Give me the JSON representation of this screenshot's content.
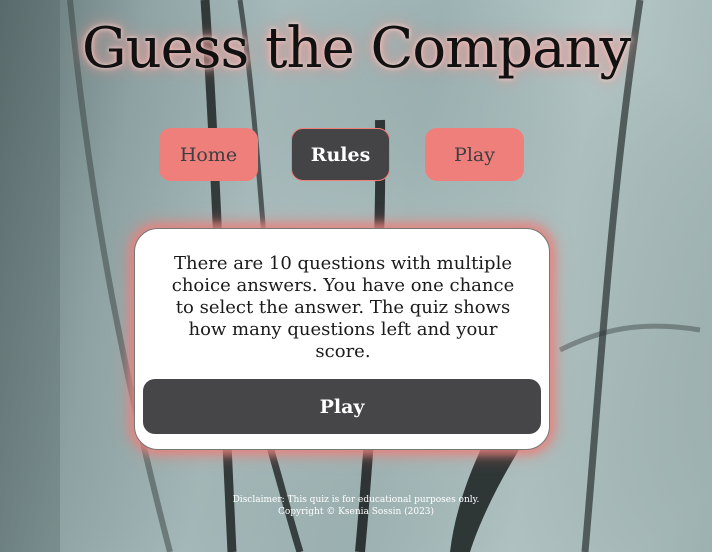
{
  "title": "Guess the Company",
  "nav": {
    "home_label": "Home",
    "rules_label": "Rules",
    "play_label": "Play"
  },
  "rules_card": {
    "text": "There are 10 questions with multiple choice answers. You have one chance to select the answer. The quiz shows how many questions left and your score.",
    "play_label": "Play"
  },
  "footer": {
    "disclaimer": "Disclaimer: This quiz is for educational purposes only.",
    "copyright": "Copyright © Ksenia Sossin (2023)"
  },
  "colors": {
    "accent": "#ee7f7b",
    "dark_button": "#444346",
    "card_bg": "#ffffff"
  }
}
